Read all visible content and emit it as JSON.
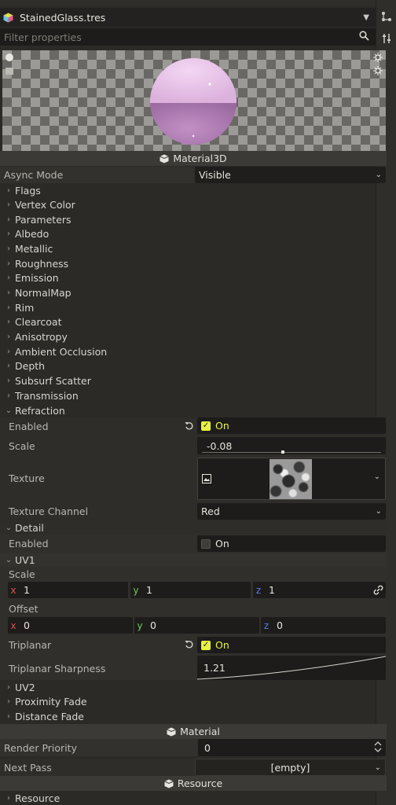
{
  "header": {
    "resource_name": "StainedGlass.tres"
  },
  "filter": {
    "placeholder": "Filter properties"
  },
  "material3d_label": "Material3D",
  "async_mode": {
    "label": "Async Mode",
    "value": "Visible"
  },
  "sections": [
    "Flags",
    "Vertex Color",
    "Parameters",
    "Albedo",
    "Metallic",
    "Roughness",
    "Emission",
    "NormalMap",
    "Rim",
    "Clearcoat",
    "Anisotropy",
    "Ambient Occlusion",
    "Depth",
    "Subsurf Scatter",
    "Transmission"
  ],
  "refraction": {
    "title": "Refraction",
    "enabled_label": "Enabled",
    "enabled_value": "On",
    "scale_label": "Scale",
    "scale_value": "-0.08",
    "texture_label": "Texture",
    "channel_label": "Texture Channel",
    "channel_value": "Red"
  },
  "detail": {
    "title": "Detail",
    "enabled_label": "Enabled",
    "enabled_value": "On"
  },
  "uv1": {
    "title": "UV1",
    "scale_label": "Scale",
    "scale_x": "1",
    "scale_y": "1",
    "scale_z": "1",
    "offset_label": "Offset",
    "offset_x": "0",
    "offset_y": "0",
    "offset_z": "0",
    "triplanar_label": "Triplanar",
    "triplanar_value": "On",
    "sharpness_label": "Triplanar Sharpness",
    "sharpness_value": "1.21",
    "axis_x": "x",
    "axis_y": "y",
    "axis_z": "z"
  },
  "sections_after": [
    "UV2",
    "Proximity Fade",
    "Distance Fade"
  ],
  "material_label": "Material",
  "render_priority": {
    "label": "Render Priority",
    "value": "0"
  },
  "next_pass": {
    "label": "Next Pass",
    "value": "[empty]"
  },
  "resource_label": "Resource",
  "resource_section": "Resource",
  "colors": {
    "accent": "#e7f53a",
    "panel": "#2b2a27",
    "field": "#1d1c1a",
    "sphere": "#c690c8"
  }
}
